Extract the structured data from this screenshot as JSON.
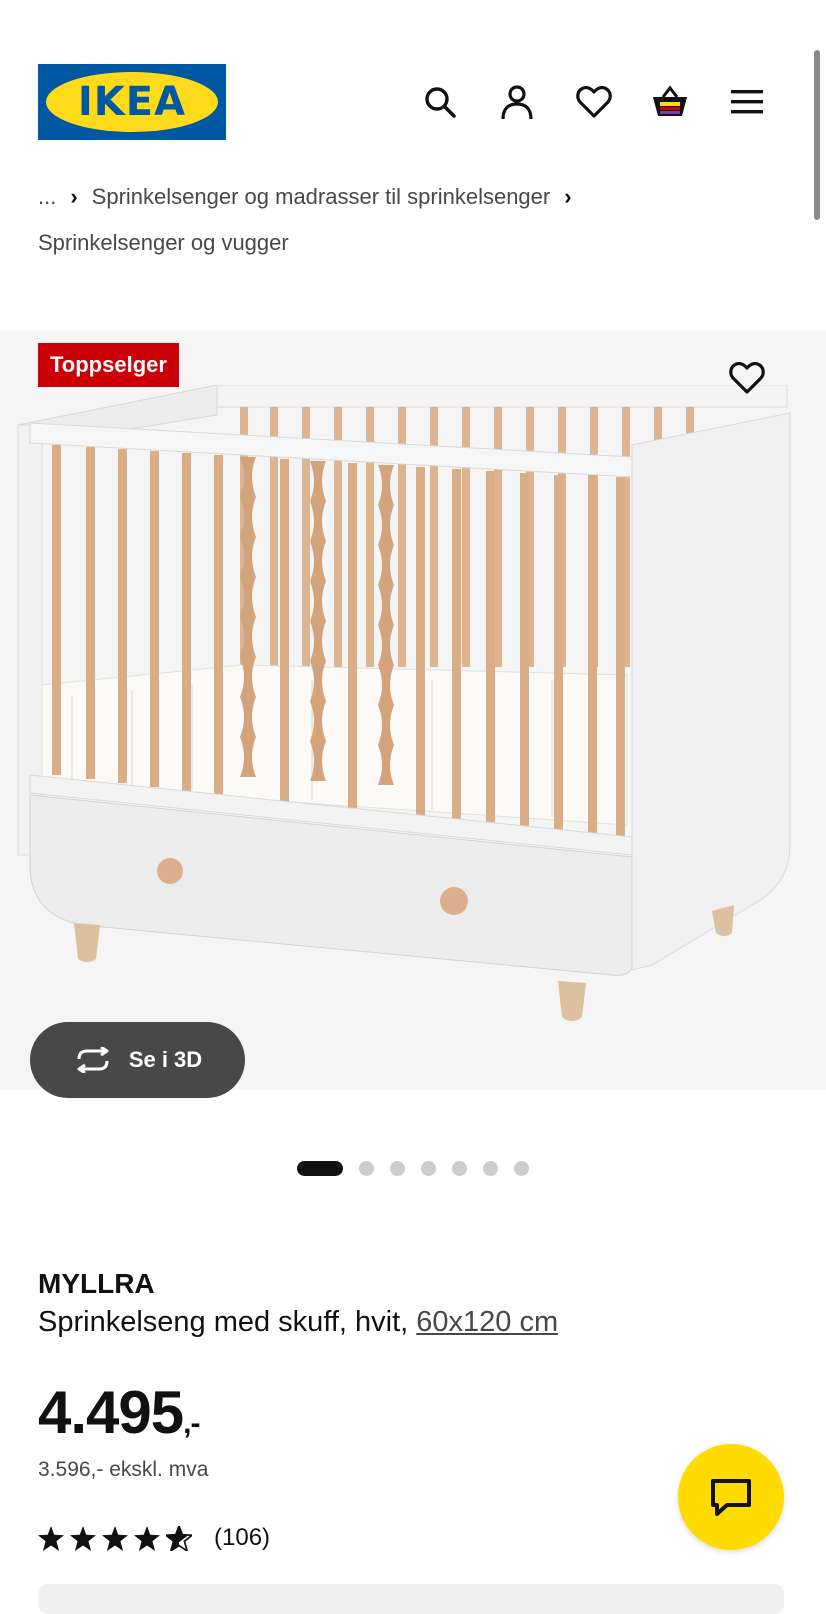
{
  "header": {
    "logo_text": "IKEA",
    "icons": [
      "search-icon",
      "account-icon",
      "favorites-icon",
      "cart-icon",
      "menu-icon"
    ]
  },
  "breadcrumb": {
    "ellipsis": "...",
    "items": [
      "Sprinkelsenger og madrasser til sprinkelsenger",
      "Sprinkelsenger og vugger"
    ]
  },
  "product": {
    "badge": "Toppselger",
    "view_3d_label": "Se i 3D",
    "name": "MYLLRA",
    "description": "Sprinkelseng med skuff, hvit,",
    "size": "60x120 cm",
    "price": "4.495",
    "price_suffix": ",-",
    "price_excl_vat": "3.596,- ekskl. mva",
    "rating_stars": 4.5,
    "review_count": "(106)"
  },
  "carousel": {
    "count": 7,
    "active_index": 0
  },
  "colors": {
    "ikea_blue": "#0058a3",
    "ikea_yellow": "#ffda1a",
    "badge_red": "#cc0008",
    "chat_yellow": "#ffdb00",
    "dark_gray": "#484848"
  }
}
